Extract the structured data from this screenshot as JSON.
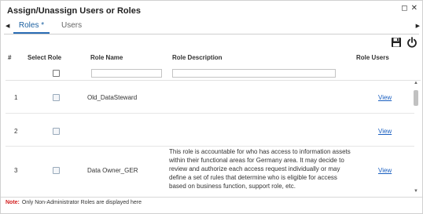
{
  "dialog": {
    "title": "Assign/Unassign Users or Roles",
    "restore_glyph": "◻",
    "close_glyph": "✕"
  },
  "tabs": [
    {
      "label": "Roles *",
      "active": true
    },
    {
      "label": "Users",
      "active": false
    }
  ],
  "toolbar": {
    "save_icon": "save-icon",
    "power_icon": "power-icon"
  },
  "table": {
    "headers": {
      "num": "#",
      "select": "Select Role",
      "name": "Role Name",
      "description": "Role Description",
      "users": "Role Users"
    },
    "filters": {
      "name_placeholder": "",
      "description_placeholder": ""
    },
    "rows": [
      {
        "num": "1",
        "name": "Old_DataSteward",
        "description": "",
        "users": "View",
        "checked": false
      },
      {
        "num": "2",
        "name": "",
        "description": "",
        "users": "View",
        "checked": false
      },
      {
        "num": "3",
        "name": "Data Owner_GER",
        "description": "This role is accountable for who has access to information assets within their functional areas for Germany area. It may decide to review and authorize each access request individually or may define a set of rules that determine who is eligible for access based on business function, support role, etc.",
        "users": "View",
        "checked": false
      }
    ]
  },
  "note": {
    "label": "Note:",
    "text": "Only Non-Administrator Roles are displayed here"
  },
  "colors": {
    "accent": "#2a6db5",
    "link": "#1a5fc0",
    "note_label": "#d32020"
  }
}
